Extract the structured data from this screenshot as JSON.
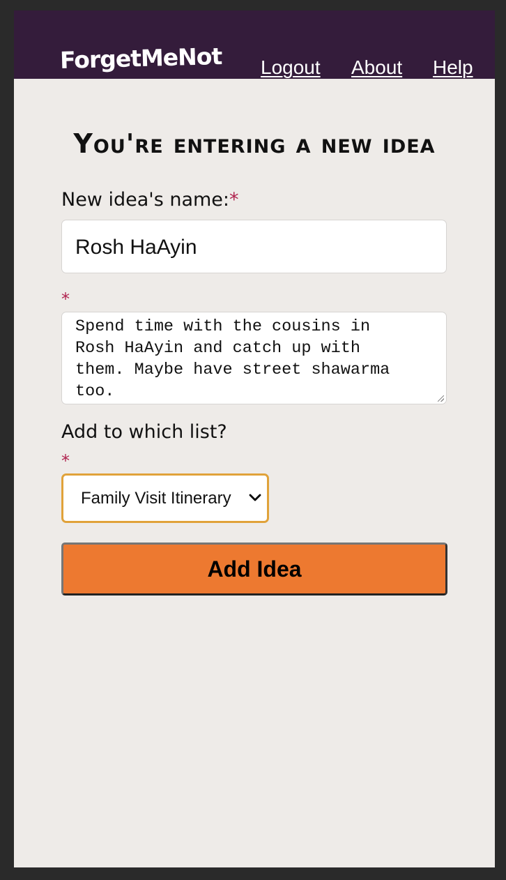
{
  "header": {
    "logo": "ForgetMeNot",
    "nav": {
      "logout": "Logout",
      "about": "About",
      "help": "Help"
    }
  },
  "form": {
    "title": "You're entering a new idea",
    "name_label": "New idea's name:",
    "required_marker": "*",
    "name_value": "Rosh HaAyin",
    "description_value": "Spend time with the cousins in\nRosh HaAyin and catch up with\nthem. Maybe have street shawarma\ntoo.",
    "list_label": "Add to which list?",
    "list_selected": "Family Visit Itinerary",
    "submit_label": "Add Idea"
  },
  "colors": {
    "header_bg": "#341c3b",
    "page_bg": "#eeebe8",
    "required": "#b0244f",
    "button": "#ed7930",
    "select_focus": "#e0a23a"
  }
}
